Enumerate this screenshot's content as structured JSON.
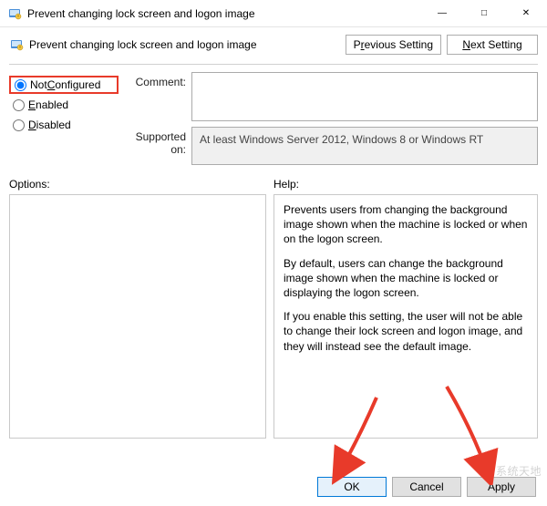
{
  "title": "Prevent changing lock screen and logon image",
  "window_controls": {
    "minimize": "—",
    "maximize": "□",
    "close": "✕"
  },
  "header": {
    "policy_title": "Prevent changing lock screen and logon image",
    "prev_btn_pre": "P",
    "prev_btn_ul": "r",
    "prev_btn_post": "evious Setting",
    "next_btn_pre": "",
    "next_btn_ul": "N",
    "next_btn_post": "ext Setting"
  },
  "state": {
    "not_configured_pre": "Not ",
    "not_configured_ul": "C",
    "not_configured_post": "onfigured",
    "enabled_ul": "E",
    "enabled_post": "nabled",
    "disabled_ul": "D",
    "disabled_post": "isabled",
    "selected": "not_configured"
  },
  "labels": {
    "comment": "Comment:",
    "supported": "Supported on:",
    "options": "Options:",
    "help": "Help:"
  },
  "comment_value": "",
  "supported_value": "At least Windows Server 2012, Windows 8 or Windows RT",
  "help": {
    "p1": "Prevents users from changing the background image shown when the machine is locked or when on the logon screen.",
    "p2": "By default, users can change the background image shown when the machine is locked or displaying the logon screen.",
    "p3": "If you enable this setting, the user will not be able to change their lock screen and logon image, and they will instead see the default image."
  },
  "footer": {
    "ok": "OK",
    "cancel": "Cancel",
    "apply": "Apply"
  },
  "watermark": "系统天地"
}
